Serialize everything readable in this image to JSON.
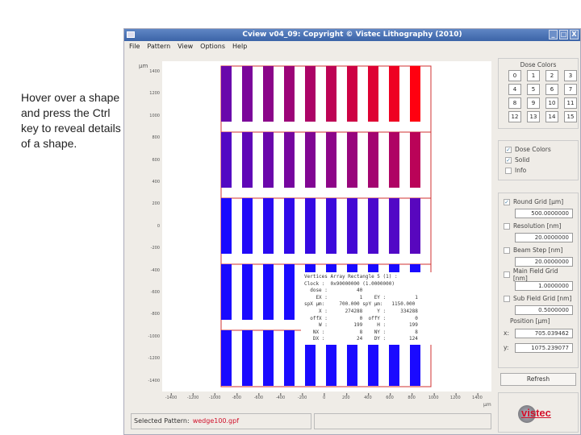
{
  "hint": "Hover over a shape and press the Ctrl key to reveal details of a shape.",
  "window": {
    "title": "Cview v04_09: Copyright © Vistec Lithography (2010)",
    "controls": [
      "_",
      "□",
      "X"
    ]
  },
  "menu": [
    "File",
    "Pattern",
    "View",
    "Options",
    "Help"
  ],
  "axes": {
    "unit": "µm",
    "y_ticks": [
      "1400",
      "1200",
      "1000",
      "800",
      "600",
      "400",
      "200",
      "0",
      "-200",
      "-400",
      "-600",
      "-800",
      "-1000",
      "-1200",
      "-1400"
    ],
    "x_ticks": [
      "-1400",
      "-1200",
      "-1000",
      "-800",
      "-600",
      "-400",
      "-200",
      "0",
      "200",
      "400",
      "600",
      "800",
      "1000",
      "1200",
      "1400"
    ]
  },
  "colors": {
    "dose_low": "#1a0aff",
    "dose_high": "#ff0010",
    "outline": "#d03030"
  },
  "tooltip": [
    "Vertices Array Rectangle 5 (1) :",
    "Clock :  0x90000000 (1.0000000)",
    "  dose :          40",
    "    EX :           1    EY :          1",
    "spX µm:     700.000 spY µm:   1150.000",
    "     X :      274288     Y :     334288",
    "  offX :           0  offY :          0",
    "     W :         199     H :        199",
    "   NX :            8    NY :          8",
    "   DX :           24    DY :        124"
  ],
  "status": {
    "label": "Selected Pattern:",
    "file": "wedge100.gpf"
  },
  "dose_panel": {
    "title": "Dose Colors",
    "buttons": [
      "0",
      "1",
      "2",
      "3",
      "4",
      "5",
      "6",
      "7",
      "8",
      "9",
      "10",
      "11",
      "12",
      "13",
      "14",
      "15"
    ]
  },
  "display": [
    {
      "label": "Dose Colors",
      "checked": true
    },
    {
      "label": "Solid",
      "checked": true
    },
    {
      "label": "Info",
      "checked": false
    }
  ],
  "grid": {
    "round": {
      "label": "Round Grid [µm]",
      "checked": true,
      "value": "500.0000000"
    },
    "resolution": {
      "label": "Resolution [nm]",
      "checked": false,
      "value": "20.0000000"
    },
    "beam": {
      "label": "Beam Step [nm]",
      "checked": false,
      "value": "20.0000000"
    },
    "main": {
      "label": "Main Field Grid [nm]",
      "checked": false,
      "value": "1.0000000"
    },
    "sub": {
      "label": "Sub Field Grid [nm]",
      "checked": false,
      "value": "0.5000000"
    },
    "position_label": "Position [µm]",
    "x_label": "x:",
    "x": "705.039462",
    "y_label": "y:",
    "y": "1075.239077"
  },
  "refresh": "Refresh",
  "logo": "vistec"
}
